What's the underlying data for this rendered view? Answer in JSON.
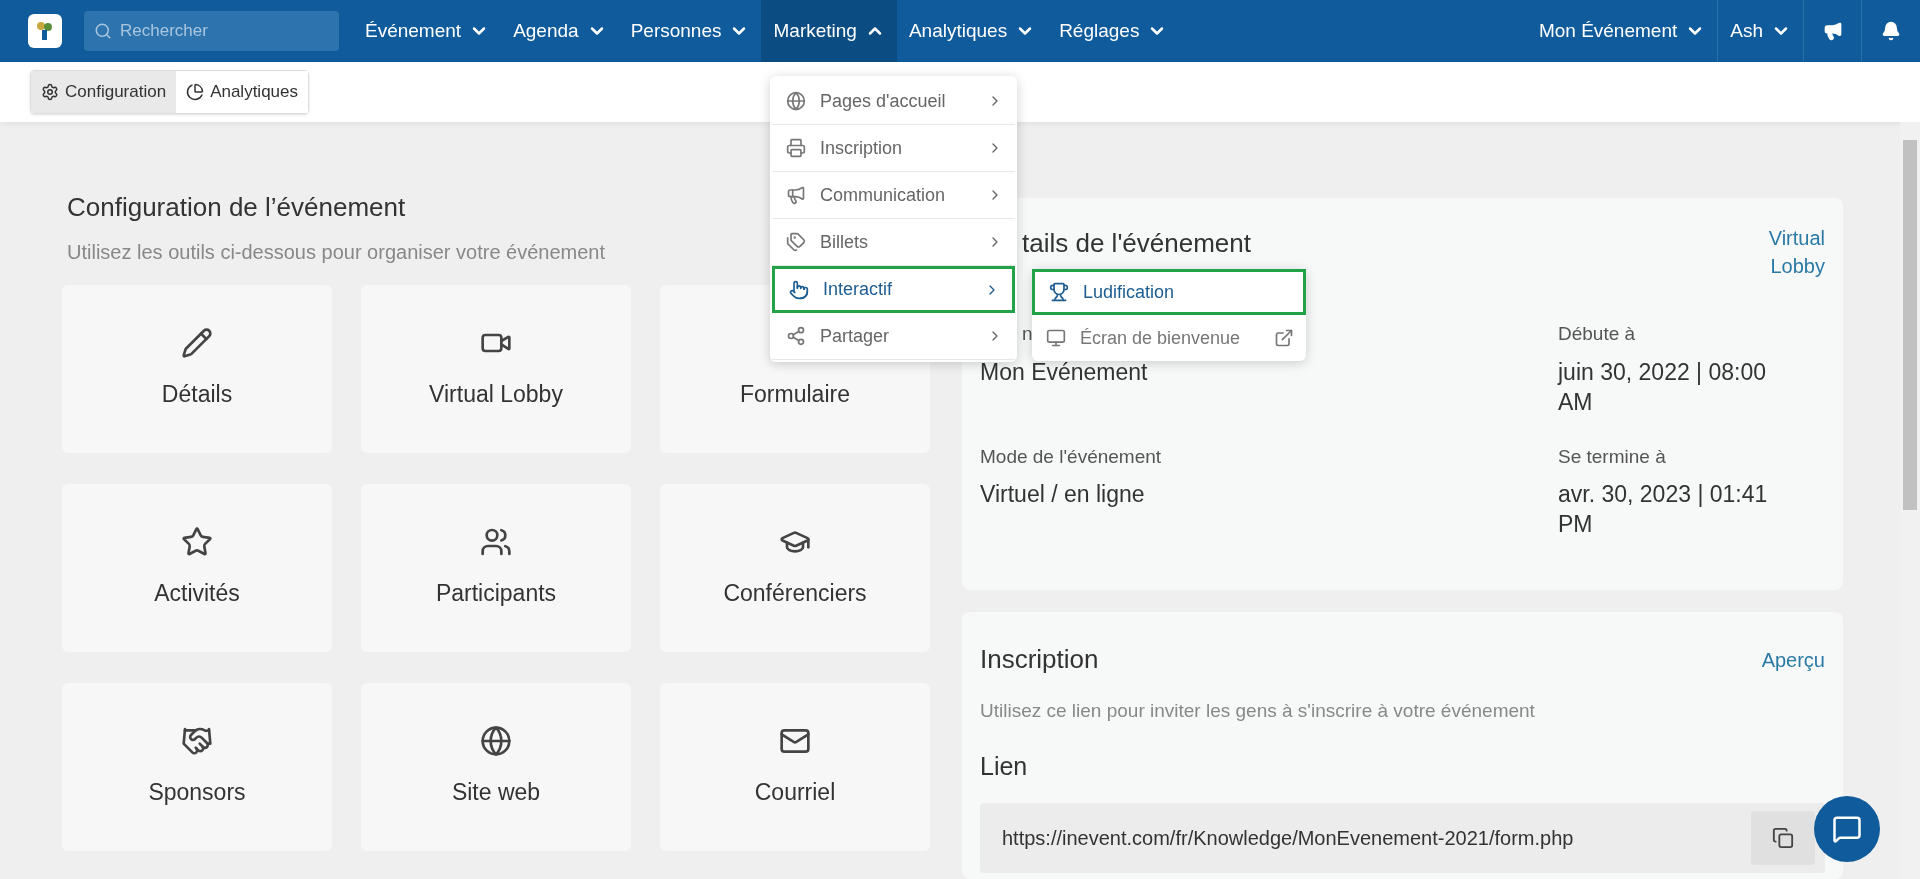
{
  "nav": {
    "search": {
      "placeholder": "Rechercher"
    },
    "items": [
      {
        "label": "Événement",
        "selected": false
      },
      {
        "label": "Agenda",
        "selected": false
      },
      {
        "label": "Personnes",
        "selected": false
      },
      {
        "label": "Marketing",
        "selected": true
      },
      {
        "label": "Analytiques",
        "selected": false
      },
      {
        "label": "Réglages",
        "selected": false
      }
    ],
    "right": [
      {
        "label": "Mon Événement"
      },
      {
        "label": "Ash"
      }
    ]
  },
  "subnav": {
    "tabs": [
      {
        "label": "Configuration",
        "kind": "gears",
        "selected": true
      },
      {
        "label": "Analytiques",
        "kind": "pie",
        "selected": false
      }
    ]
  },
  "setup": {
    "title": "Configuration de l’événement",
    "subtitle": "Utilisez les outils ci-dessous pour organiser votre événement",
    "tiles": [
      {
        "label": "Détails",
        "kind": "pencil"
      },
      {
        "label": "Virtual Lobby",
        "kind": "video"
      },
      {
        "label": "Formulaire"
      },
      {
        "label": "Activités",
        "kind": "star"
      },
      {
        "label": "Participants",
        "kind": "users"
      },
      {
        "label": "Conférenciers",
        "kind": "cap"
      },
      {
        "label": "Sponsors",
        "kind": "handshake"
      },
      {
        "label": "Site web",
        "kind": "globe"
      },
      {
        "label": "Courriel",
        "kind": "mail"
      }
    ]
  },
  "menu": {
    "items": [
      {
        "label": "Pages d'accueil",
        "kind": "globe",
        "highlighted": false
      },
      {
        "label": "Inscription",
        "kind": "printer",
        "highlighted": false
      },
      {
        "label": "Communication",
        "kind": "megaphone",
        "highlighted": false
      },
      {
        "label": "Billets",
        "kind": "tags",
        "highlighted": false
      },
      {
        "label": "Interactif",
        "kind": "pointer",
        "highlighted": true
      },
      {
        "label": "Partager",
        "kind": "share",
        "highlighted": false
      }
    ]
  },
  "submenu": {
    "items": [
      {
        "label": "Ludification",
        "kind": "trophy",
        "highlighted": true,
        "external": false
      },
      {
        "label": "Écran de bienvenue",
        "kind": "monitor",
        "highlighted": false,
        "external": true
      }
    ]
  },
  "details": {
    "title": "tails de l'événement",
    "link": "Virtual Lobby",
    "fields": [
      {
        "label": "n",
        "value": "Mon Evénement"
      },
      {
        "label": "Débute à",
        "value": "juin 30, 2022 | 08:00 AM"
      },
      {
        "label": "Mode de l'événement",
        "value": "Virtuel / en ligne"
      },
      {
        "label": "Se termine à",
        "value": "avr. 30, 2023 | 01:41 PM"
      }
    ]
  },
  "registration": {
    "title": "Inscription",
    "link": "Aperçu",
    "description": "Utilisez ce lien pour inviter les gens à s'inscrire à votre événement",
    "link_label": "Lien",
    "url": "https://inevent.com/fr/Knowledge/MonEvenement-2021/form.php"
  }
}
